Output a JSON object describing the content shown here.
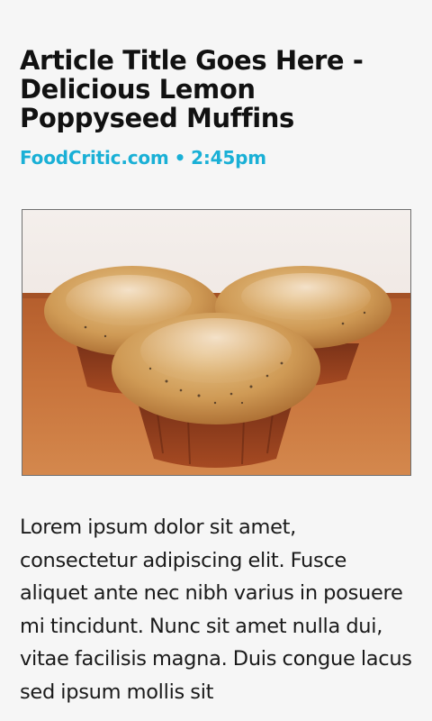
{
  "article": {
    "title": "Article Title Goes Here - Delicious Lemon Poppyseed Muffins",
    "source": "FoodCritic.com",
    "separator": "•",
    "time": "2:45pm",
    "body": "Lorem ipsum dolor sit amet, consectetur adipiscing elit. Fusce aliquet ante nec nibh varius in posuere mi tincidunt. Nunc sit amet nulla dui, vitae facilisis magna. Duis congue lacus sed ipsum mollis sit"
  },
  "colors": {
    "background": "#f6f6f6",
    "accent": "#1ab0d6",
    "text": "#111111"
  }
}
